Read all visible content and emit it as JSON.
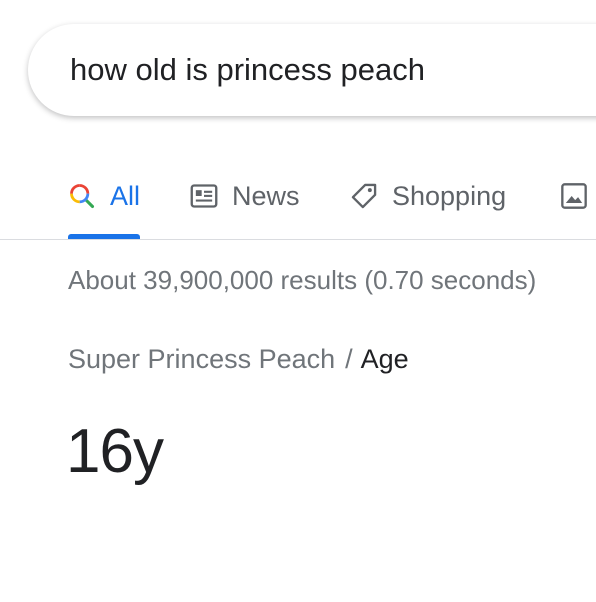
{
  "search": {
    "query": "how old is princess peach"
  },
  "tabs": [
    {
      "label": "All",
      "icon": "search-icon",
      "active": true
    },
    {
      "label": "News",
      "icon": "news-icon",
      "active": false
    },
    {
      "label": "Shopping",
      "icon": "tag-icon",
      "active": false
    },
    {
      "label": "",
      "icon": "image-icon",
      "active": false
    }
  ],
  "colors": {
    "accent": "#1a73e8",
    "text_primary": "#202124",
    "text_secondary": "#70757a",
    "tab_inactive": "#5f6368"
  },
  "results": {
    "stats": "About 39,900,000 results (0.70 seconds)"
  },
  "answer": {
    "breadcrumb_parent": "Super Princess Peach",
    "breadcrumb_separator": "/",
    "breadcrumb_current": "Age",
    "value": "16y"
  }
}
